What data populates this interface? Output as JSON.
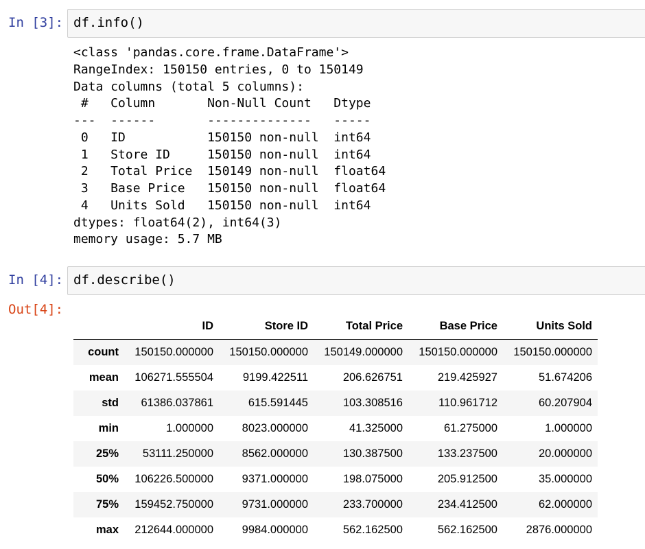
{
  "cells": [
    {
      "in_prompt": "In [3]:",
      "code": "df.info()",
      "stdout": [
        "<class 'pandas.core.frame.DataFrame'>",
        "RangeIndex: 150150 entries, 0 to 150149",
        "Data columns (total 5 columns):",
        " #   Column       Non-Null Count   Dtype  ",
        "---  ------       --------------   -----  ",
        " 0   ID           150150 non-null  int64  ",
        " 1   Store ID     150150 non-null  int64  ",
        " 2   Total Price  150149 non-null  float64",
        " 3   Base Price   150150 non-null  float64",
        " 4   Units Sold   150150 non-null  int64  ",
        "dtypes: float64(2), int64(3)",
        "memory usage: 5.7 MB"
      ]
    },
    {
      "in_prompt": "In [4]:",
      "code": "df.describe()",
      "out_prompt": "Out[4]:",
      "table": {
        "columns": [
          "",
          "ID",
          "Store ID",
          "Total Price",
          "Base Price",
          "Units Sold"
        ],
        "rows": [
          [
            "count",
            "150150.000000",
            "150150.000000",
            "150149.000000",
            "150150.000000",
            "150150.000000"
          ],
          [
            "mean",
            "106271.555504",
            "9199.422511",
            "206.626751",
            "219.425927",
            "51.674206"
          ],
          [
            "std",
            "61386.037861",
            "615.591445",
            "103.308516",
            "110.961712",
            "60.207904"
          ],
          [
            "min",
            "1.000000",
            "8023.000000",
            "41.325000",
            "61.275000",
            "1.000000"
          ],
          [
            "25%",
            "53111.250000",
            "8562.000000",
            "130.387500",
            "133.237500",
            "20.000000"
          ],
          [
            "50%",
            "106226.500000",
            "9371.000000",
            "198.075000",
            "205.912500",
            "35.000000"
          ],
          [
            "75%",
            "159452.750000",
            "9731.000000",
            "233.700000",
            "234.412500",
            "62.000000"
          ],
          [
            "max",
            "212644.000000",
            "9984.000000",
            "562.162500",
            "562.162500",
            "2876.000000"
          ]
        ]
      }
    }
  ]
}
